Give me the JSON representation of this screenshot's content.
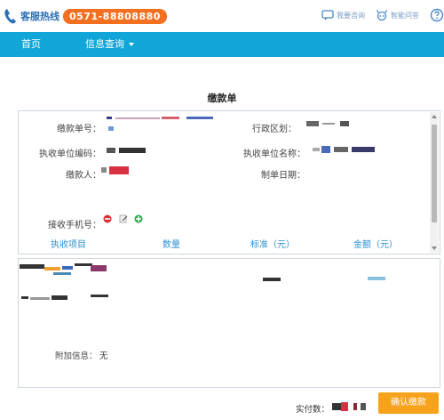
{
  "header": {
    "hotline_label": "客服热线",
    "hotline_number": "0571-88808880",
    "links": [
      {
        "label": "我要咨询",
        "icon": "chat-icon"
      },
      {
        "label": "智能问答",
        "icon": "robot-icon"
      }
    ],
    "help_icon": "help-icon"
  },
  "nav": {
    "home": "首页",
    "info_query": "信息查询"
  },
  "form": {
    "title": "缴款单",
    "fields": {
      "bill_no_label": "缴款单号：",
      "region_label": "行政区划：",
      "unit_code_label": "执收单位编码：",
      "unit_name_label": "执收单位名称：",
      "payer_label": "缴款人：",
      "date_label": "制单日期：",
      "phone_label": "接收手机号："
    },
    "columns": [
      "执收项目",
      "数量",
      "标准（元）",
      "金额（元）"
    ],
    "extra_label": "附加信息：",
    "extra_value": "无"
  },
  "footer": {
    "paid_label": "实付数：",
    "confirm_button": "确认缴款"
  },
  "colors": {
    "nav_bg": "#12a6d8",
    "hotline_bg": "#f37021",
    "confirm_bg": "#f7a21b",
    "column_text": "#2b8fd0"
  }
}
